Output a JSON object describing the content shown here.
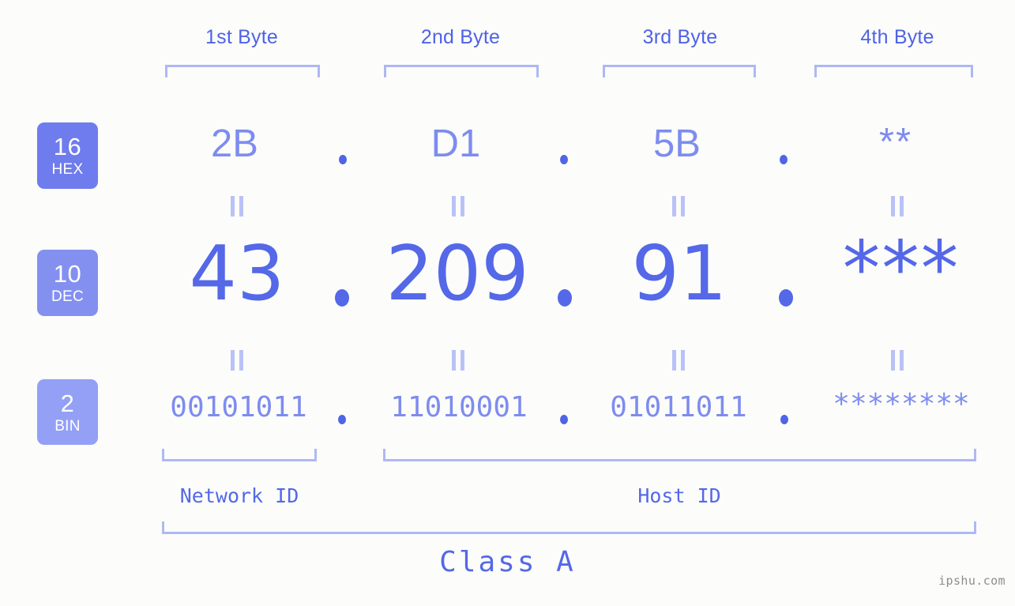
{
  "background_color": "#fcfdfa",
  "accent_color": "#5468e8",
  "accent_light": "#7e8cf0",
  "bracket_color": "#aeb8f5",
  "byte_headers": [
    {
      "label": "1st Byte"
    },
    {
      "label": "2nd Byte"
    },
    {
      "label": "3rd Byte"
    },
    {
      "label": "4th Byte"
    }
  ],
  "rows": {
    "hex": {
      "badge_number": "16",
      "badge_name": "HEX",
      "badge_color": "#6e7ced",
      "values": [
        "2B",
        "D1",
        "5B",
        "**"
      ],
      "separator": "."
    },
    "dec": {
      "badge_number": "10",
      "badge_name": "DEC",
      "badge_color": "#8490f0",
      "values": [
        "43",
        "209",
        "91",
        "***"
      ],
      "separator": "."
    },
    "bin": {
      "badge_number": "2",
      "badge_name": "BIN",
      "badge_color": "#93a0f5",
      "values": [
        "00101011",
        "11010001",
        "01011011",
        "********"
      ],
      "separator": "."
    }
  },
  "equality_symbol": "||",
  "id_labels": {
    "network": "Network ID",
    "host": "Host ID"
  },
  "class_label": "Class A",
  "watermark": "ipshu.com"
}
